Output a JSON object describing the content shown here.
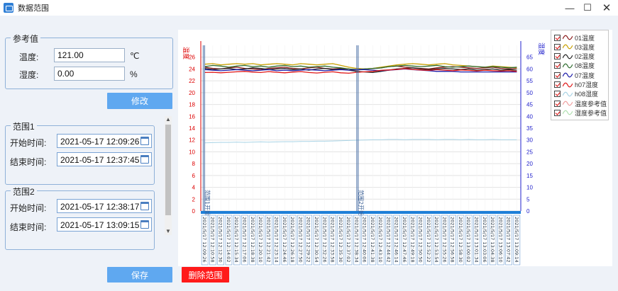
{
  "window": {
    "title": "数据范围",
    "min_glyph": "—",
    "max_glyph": "☐",
    "close_glyph": "✕"
  },
  "reference": {
    "group_title": "参考值",
    "temp_label": "温度:",
    "temp_value": "121.00",
    "temp_unit": "℃",
    "humid_label": "湿度:",
    "humid_value": "0.00",
    "humid_unit": "%",
    "modify_button": "修改"
  },
  "ranges": [
    {
      "title": "范围1",
      "start_label": "开始时间:",
      "start": "2021-05-17 12:09:26",
      "end_label": "结束时间:",
      "end": "2021-05-17 12:37:45"
    },
    {
      "title": "范围2",
      "start_label": "开始时间:",
      "start": "2021-05-17 12:38:17",
      "end_label": "结束时间:",
      "end": "2021-05-17 13:09:15"
    }
  ],
  "buttons": {
    "save": "保存",
    "delete": "删除范围"
  },
  "chart_data": {
    "type": "line",
    "y_left_label": "温度",
    "y_right_label": "湿度",
    "y_left_range": [
      0,
      28
    ],
    "y_right_range": [
      0,
      70
    ],
    "y_left_ticks": [
      "0",
      "2",
      "4",
      "6",
      "8",
      "10",
      "12",
      "14",
      "16",
      "18",
      "20",
      "22",
      "24",
      "26"
    ],
    "y_right_ticks": [
      "0",
      "5",
      "10",
      "15",
      "20",
      "25",
      "30",
      "35",
      "40",
      "45",
      "50",
      "55",
      "60",
      "65"
    ],
    "x_ticks": [
      "2021/5/17 12:09:26",
      "2021/5/17 12:10:58",
      "2021/5/17 12:12:30",
      "2021/5/17 12:14:02",
      "2021/5/17 12:15:34",
      "2021/5/17 12:17:06",
      "2021/5/17 12:18:38",
      "2021/5/17 12:20:10",
      "2021/5/17 12:21:42",
      "2021/5/17 12:23:14",
      "2021/5/17 12:24:46",
      "2021/5/17 12:26:18",
      "2021/5/17 12:27:50",
      "2021/5/17 12:29:22",
      "2021/5/17 12:30:54",
      "2021/5/17 12:32:26",
      "2021/5/17 12:33:58",
      "2021/5/17 12:35:30",
      "2021/5/17 12:37:02",
      "2021/5/17 12:38:34",
      "2021/5/17 12:40:06",
      "2021/5/17 12:41:38",
      "2021/5/17 12:43:10",
      "2021/5/17 12:44:42",
      "2021/5/17 12:46:14",
      "2021/5/17 12:47:46",
      "2021/5/17 12:49:18",
      "2021/5/17 12:50:50",
      "2021/5/17 12:52:22",
      "2021/5/17 12:53:54",
      "2021/5/17 12:55:26",
      "2021/5/17 12:56:58",
      "2021/5/17 12:58:30",
      "2021/5/17 13:00:02",
      "2021/5/17 13:01:34",
      "2021/5/17 13:03:06",
      "2021/5/17 13:04:38",
      "2021/5/17 13:06:10",
      "2021/5/17 13:07:42",
      "2021/5/17 13:09:14"
    ],
    "range_markers": [
      {
        "label": "范围1开始",
        "x_index": 0.3
      },
      {
        "label": "范围2开始",
        "x_index": 19.5
      }
    ],
    "series": [
      {
        "name": "01温度",
        "axis": "left",
        "color": "#8b1a1a",
        "values": [
          24.3,
          24.1,
          24.0,
          24.2,
          24.3,
          24.1,
          24.0,
          23.9,
          24.1,
          24.2,
          24.3,
          24.1,
          24.0,
          24.2,
          24.3,
          24.1,
          24.0,
          24.1,
          24.0,
          23.8,
          24.0,
          24.1,
          24.2,
          24.4,
          24.5,
          24.3,
          24.2,
          24.1,
          24.0,
          24.2,
          24.3,
          24.4,
          24.3,
          24.2,
          24.1,
          24.2,
          24.3,
          24.1,
          24.0,
          24.1
        ]
      },
      {
        "name": "03温度",
        "axis": "left",
        "color": "#c8a000",
        "values": [
          24.8,
          24.9,
          24.7,
          24.8,
          24.9,
          24.8,
          24.9,
          24.7,
          24.8,
          24.9,
          24.8,
          24.7,
          24.9,
          24.8,
          24.7,
          24.8,
          24.9,
          24.6,
          24.3,
          24.1,
          24.0,
          24.1,
          24.3,
          24.5,
          24.7,
          24.8,
          24.9,
          24.8,
          24.7,
          24.8,
          24.9,
          24.7,
          24.6,
          24.5,
          24.4,
          24.3,
          24.5,
          24.4,
          24.3,
          24.2
        ]
      },
      {
        "name": "02温度",
        "axis": "left",
        "color": "#222222",
        "values": [
          24.1,
          23.9,
          24.0,
          24.1,
          23.9,
          24.0,
          24.2,
          24.1,
          23.9,
          24.0,
          24.1,
          23.9,
          24.0,
          23.8,
          24.0,
          24.1,
          23.9,
          24.0,
          23.8,
          23.6,
          23.5,
          23.4,
          23.6,
          23.8,
          24.0,
          24.1,
          24.2,
          24.0,
          23.9,
          24.0,
          24.1,
          24.0,
          23.9,
          24.0,
          23.8,
          23.9,
          24.0,
          23.8,
          23.9,
          23.8
        ]
      },
      {
        "name": "08温度",
        "axis": "left",
        "color": "#2e6b2e",
        "values": [
          24.4,
          24.6,
          24.5,
          24.3,
          24.5,
          24.6,
          24.4,
          24.5,
          24.3,
          24.5,
          24.6,
          24.4,
          24.5,
          24.3,
          24.4,
          24.5,
          24.3,
          24.2,
          24.0,
          23.9,
          24.0,
          24.1,
          24.2,
          24.4,
          24.5,
          24.6,
          24.5,
          24.4,
          24.5,
          24.6,
          24.4,
          24.3,
          24.4,
          24.5,
          24.4,
          24.3,
          24.4,
          24.3,
          24.2,
          24.3
        ]
      },
      {
        "name": "07温度",
        "axis": "left",
        "color": "#1a1aa8",
        "values": [
          23.9,
          23.8,
          23.7,
          23.8,
          23.9,
          23.8,
          23.7,
          23.8,
          23.9,
          23.7,
          23.8,
          23.7,
          23.8,
          23.9,
          23.8,
          23.7,
          23.8,
          23.9,
          23.8,
          23.9,
          23.9,
          23.8,
          23.7,
          23.8,
          23.9,
          24.0,
          23.9,
          23.8,
          23.7,
          23.6,
          23.6,
          23.6,
          23.5,
          23.5,
          23.5,
          23.5,
          23.5,
          23.5,
          23.5,
          23.5
        ]
      },
      {
        "name": "h07湿度",
        "axis": "right",
        "color": "#e01818",
        "values": [
          58.5,
          58.6,
          58.4,
          58.6,
          58.8,
          59.0,
          58.7,
          58.5,
          58.9,
          58.6,
          58.4,
          58.7,
          58.9,
          58.5,
          58.3,
          58.6,
          58.8,
          58.4,
          58.2,
          58.6,
          58.8,
          59.0,
          59.4,
          59.6,
          59.8,
          60.2,
          59.8,
          59.6,
          59.4,
          59.7,
          59.5,
          59.3,
          59.6,
          59.4,
          59.2,
          59.5,
          59.3,
          59.1,
          59.3,
          59.0
        ]
      },
      {
        "name": "h08湿度",
        "axis": "right",
        "color": "#a9d4e6",
        "values": [
          28.8,
          28.9,
          29.0,
          29.0,
          29.1,
          29.0,
          29.1,
          29.2,
          29.1,
          29.2,
          29.3,
          29.3,
          29.4,
          29.4,
          29.5,
          29.5,
          29.6,
          29.7,
          29.8,
          29.9,
          30.0,
          30.1,
          30.1,
          30.2,
          30.2,
          30.1,
          30.2,
          30.2,
          30.2,
          30.1,
          30.2,
          30.2,
          30.1,
          30.2,
          30.1,
          30.1,
          30.2,
          30.1,
          30.1,
          30.1
        ]
      }
    ],
    "legend": [
      {
        "label": "01温度",
        "color": "#8b1a1a"
      },
      {
        "label": "03温度",
        "color": "#c8a000"
      },
      {
        "label": "02温度",
        "color": "#222222"
      },
      {
        "label": "08温度",
        "color": "#2e6b2e"
      },
      {
        "label": "07温度",
        "color": "#1a1aa8"
      },
      {
        "label": "h07湿度",
        "color": "#e01818"
      },
      {
        "label": "h08湿度",
        "color": "#a9d4e6"
      },
      {
        "label": "温度参考值",
        "color": "#f0a0a0"
      },
      {
        "label": "湿度参考值",
        "color": "#b0e0b0"
      }
    ],
    "legend_position": "right"
  }
}
